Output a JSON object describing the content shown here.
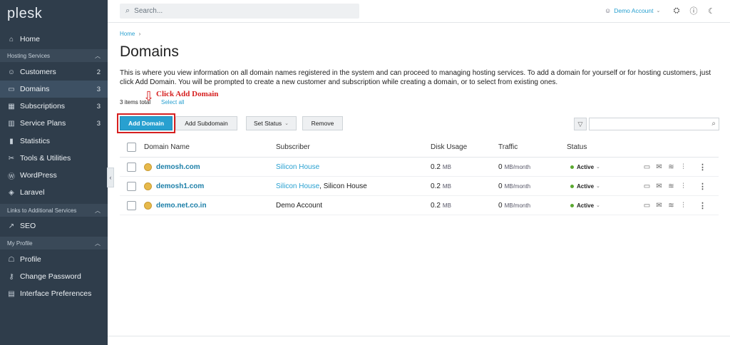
{
  "app": {
    "logo": "plesk"
  },
  "sidebar": {
    "home": "Home",
    "sections": {
      "hosting": "Hosting Services",
      "links": "Links to Additional Services",
      "profile": "My Profile"
    },
    "hosting_items": [
      {
        "label": "Customers",
        "count": "2",
        "icon": "person-icon"
      },
      {
        "label": "Domains",
        "count": "3",
        "icon": "monitor-icon"
      },
      {
        "label": "Subscriptions",
        "count": "3",
        "icon": "grid-icon"
      },
      {
        "label": "Service Plans",
        "count": "3",
        "icon": "book-icon"
      },
      {
        "label": "Statistics",
        "count": "",
        "icon": "chart-icon"
      },
      {
        "label": "Tools & Utilities",
        "count": "",
        "icon": "tools-icon"
      },
      {
        "label": "WordPress",
        "count": "",
        "icon": "wordpress-icon"
      },
      {
        "label": "Laravel",
        "count": "",
        "icon": "laravel-icon"
      }
    ],
    "link_items": [
      {
        "label": "SEO",
        "icon": "seo-icon"
      }
    ],
    "profile_items": [
      {
        "label": "Profile",
        "icon": "profile-icon"
      },
      {
        "label": "Change Password",
        "icon": "key-icon"
      },
      {
        "label": "Interface Preferences",
        "icon": "preferences-icon"
      }
    ]
  },
  "header": {
    "search_placeholder": "Search...",
    "account": "Demo Account"
  },
  "main": {
    "breadcrumb": "Home",
    "title": "Domains",
    "description": "This is where you view information on all domain names registered in the system and can proceed to managing hosting services. To add a domain for yourself or for hosting customers, just click Add Domain. You will be prompted to create a new customer and subscription while creating a domain, or to select from existing ones.",
    "items_total": "3 items total",
    "select_all": "Select all",
    "callout": "Click Add Domain",
    "toolbar": {
      "add_domain": "Add Domain",
      "add_subdomain": "Add Subdomain",
      "set_status": "Set Status",
      "remove": "Remove"
    },
    "columns": {
      "domain": "Domain Name",
      "subscriber": "Subscriber",
      "disk": "Disk Usage",
      "traffic": "Traffic",
      "status": "Status"
    },
    "rows": [
      {
        "domain": "demosh.com",
        "subscriber_link": "Silicon House",
        "subscriber_extra": "",
        "disk": "0.2",
        "disk_unit": "MB",
        "traffic": "0",
        "traffic_unit": "MB/month",
        "status": "Active"
      },
      {
        "domain": "demosh1.com",
        "subscriber_link": "Silicon House",
        "subscriber_extra": ", Silicon House",
        "disk": "0.2",
        "disk_unit": "MB",
        "traffic": "0",
        "traffic_unit": "MB/month",
        "status": "Active"
      },
      {
        "domain": "demo.net.co.in",
        "subscriber_link": "",
        "subscriber_extra": "Demo Account",
        "disk": "0.2",
        "disk_unit": "MB",
        "traffic": "0",
        "traffic_unit": "MB/month",
        "status": "Active"
      }
    ]
  }
}
